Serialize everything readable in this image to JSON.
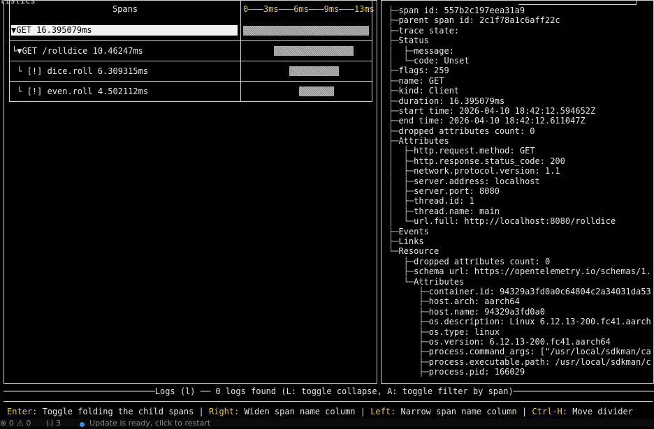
{
  "window": {
    "tab_stub": "tistics"
  },
  "span_table": {
    "header_spans": "Spans",
    "header_timeline": "0———3ms———6ms———9ms———13ms",
    "rows": [
      {
        "label": "▼GET 16.395079ms",
        "selected": true
      },
      {
        "label": "└▼GET /rolldice 10.46247ms",
        "selected": false
      },
      {
        "label": " └ [!] dice.roll 6.309315ms",
        "selected": false
      },
      {
        "label": " └ [!] even.roll 4.502112ms",
        "selected": false
      }
    ]
  },
  "span_details": [
    {
      "prefix": "├─",
      "text": "span id: 557b2c197eea31a9"
    },
    {
      "prefix": "├─",
      "text": "parent span id: 2c1f78a1c6aff22c"
    },
    {
      "prefix": "├─",
      "text": "trace state:"
    },
    {
      "prefix": "├─",
      "text": "Status"
    },
    {
      "prefix": "│  ├─",
      "text": "message:"
    },
    {
      "prefix": "│  └─",
      "text": "code: Unset"
    },
    {
      "prefix": "├─",
      "text": "flags: 259"
    },
    {
      "prefix": "├─",
      "text": "name: GET"
    },
    {
      "prefix": "├─",
      "text": "kind: Client"
    },
    {
      "prefix": "├─",
      "text": "duration: 16.395079ms"
    },
    {
      "prefix": "├─",
      "text": "start time: 2026-04-10 18:42:12.594652Z"
    },
    {
      "prefix": "├─",
      "text": "end time: 2026-04-10 18:42:12.611047Z"
    },
    {
      "prefix": "├─",
      "text": "dropped attributes count: 0"
    },
    {
      "prefix": "├─",
      "text": "Attributes"
    },
    {
      "prefix": "│  ├─",
      "text": "http.request.method: GET"
    },
    {
      "prefix": "│  ├─",
      "text": "http.response.status_code: 200"
    },
    {
      "prefix": "│  ├─",
      "text": "network.protocol.version: 1.1"
    },
    {
      "prefix": "│  ├─",
      "text": "server.address: localhost"
    },
    {
      "prefix": "│  ├─",
      "text": "server.port: 8080"
    },
    {
      "prefix": "│  ├─",
      "text": "thread.id: 1"
    },
    {
      "prefix": "│  ├─",
      "text": "thread.name: main"
    },
    {
      "prefix": "│  └─",
      "text": "url.full: http://localhost:8080/rolldice"
    },
    {
      "prefix": "├─",
      "text": "Events"
    },
    {
      "prefix": "├─",
      "text": "Links"
    },
    {
      "prefix": "└─",
      "text": "Resource"
    },
    {
      "prefix": "   ├─",
      "text": "dropped attributes count: 0"
    },
    {
      "prefix": "   ├─",
      "text": "schema url: https://opentelemetry.io/schemas/1."
    },
    {
      "prefix": "   └─",
      "text": "Attributes"
    },
    {
      "prefix": "      ├─",
      "text": "container.id: 94329a3fd0a0c64804c2a34031da53"
    },
    {
      "prefix": "      ├─",
      "text": "host.arch: aarch64"
    },
    {
      "prefix": "      ├─",
      "text": "host.name: 94329a3fd0a0"
    },
    {
      "prefix": "      ├─",
      "text": "os.description: Linux 6.12.13-200.fc41.aarch"
    },
    {
      "prefix": "      ├─",
      "text": "os.type: linux"
    },
    {
      "prefix": "      ├─",
      "text": "os.version: 6.12.13-200.fc41.aarch64"
    },
    {
      "prefix": "      ├─",
      "text": "process.command_args: [\"/usr/local/sdkman/ca"
    },
    {
      "prefix": "      ├─",
      "text": "process.executable.path: /usr/local/sdkman/c"
    },
    {
      "prefix": "      ├─",
      "text": "process.pid: 166029"
    }
  ],
  "logs": {
    "title": "──────────────────────────────Logs (l) ── 0 logs found (L: toggle collapse, A: toggle filter by span)───────────────────────────────"
  },
  "help": {
    "k1": "Enter:",
    "t1": " Toggle folding the child spans | ",
    "k2": "Right:",
    "t2": " Widen span name column | ",
    "k3": "Left:",
    "t3": " Narrow span name column | ",
    "k4": "Ctrl-H:",
    "t4": " Move divider"
  },
  "status_bar": {
    "errors": "⊗ 0",
    "warnings": "⚠ 0",
    "ports": "(ᵢ) 3",
    "update": "Update is ready, click to restart"
  },
  "colors": {
    "accent_yellow": "#e8c94a",
    "update_dot": "#3b8eea"
  }
}
